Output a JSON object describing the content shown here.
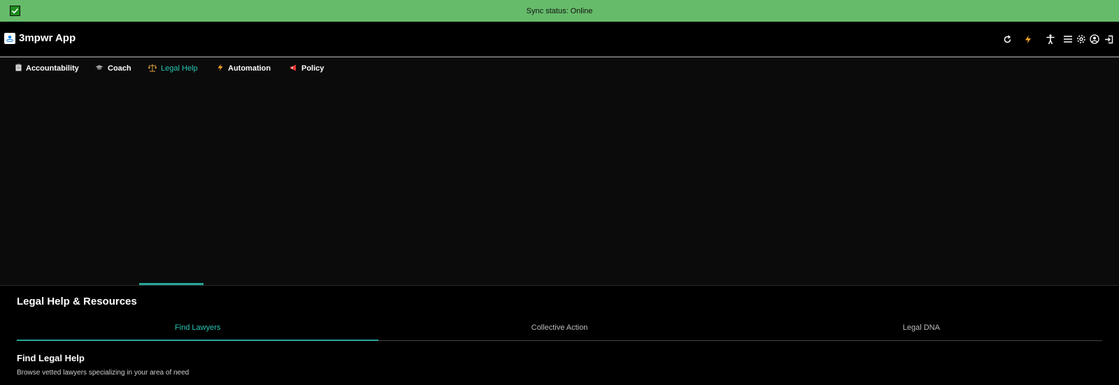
{
  "sync": {
    "status_text": "Sync status: Online",
    "status_color": "#66bb6a",
    "check_icon": "checkbox-checked-icon"
  },
  "header": {
    "app_title": "3mpwr App",
    "logo_icon": "app-logo-icon",
    "icons": [
      "refresh-icon",
      "lightning-icon",
      "accessibility-icon",
      "menu-icon",
      "settings-icon",
      "account-icon",
      "logout-icon"
    ]
  },
  "main_tabs": [
    {
      "label": "Accountability",
      "icon": "clipboard-icon"
    },
    {
      "label": "Coach",
      "icon": "graduation-cap-icon"
    },
    {
      "label": "Legal Help",
      "icon": "scales-icon",
      "active": true
    },
    {
      "label": "Automation",
      "icon": "lightning-icon"
    },
    {
      "label": "Policy",
      "icon": "megaphone-icon"
    }
  ],
  "accent_color": "#26a69a",
  "section": {
    "title": "Legal Help & Resources",
    "sub_tabs": [
      {
        "label": "Find Lawyers",
        "active": true
      },
      {
        "label": "Collective Action"
      },
      {
        "label": "Legal DNA"
      }
    ]
  },
  "find": {
    "title": "Find Legal Help",
    "subtitle": "Browse vetted lawyers specializing in your area of need"
  }
}
